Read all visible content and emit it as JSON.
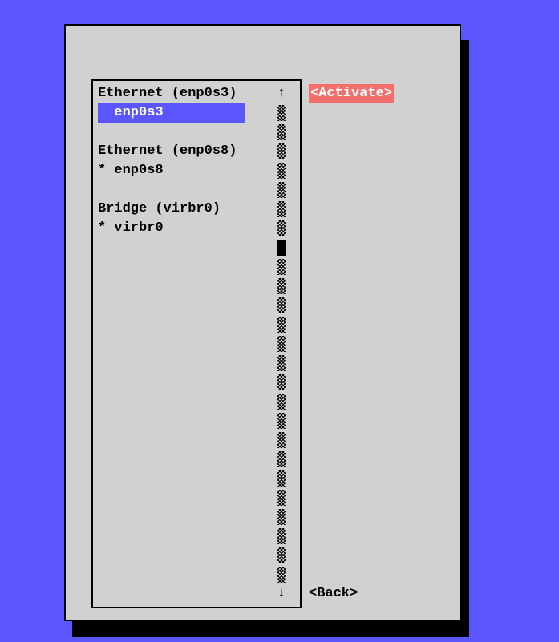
{
  "list": {
    "lines": [
      {
        "text": "Ethernet (enp0s3)",
        "selected": false,
        "prefix": ""
      },
      {
        "text": "enp0s3",
        "selected": true,
        "prefix": "  "
      },
      {
        "text": "",
        "selected": false,
        "prefix": ""
      },
      {
        "text": "Ethernet (enp0s8)",
        "selected": false,
        "prefix": ""
      },
      {
        "text": "* enp0s8",
        "selected": false,
        "prefix": ""
      },
      {
        "text": "",
        "selected": false,
        "prefix": ""
      },
      {
        "text": "Bridge (virbr0)",
        "selected": false,
        "prefix": ""
      },
      {
        "text": "* virbr0",
        "selected": false,
        "prefix": ""
      }
    ]
  },
  "scroll": {
    "up_arrow": "↑",
    "down_arrow": "↓",
    "cells": 25,
    "thumb_index": 7
  },
  "buttons": {
    "activate": "<Activate>",
    "back": "<Back>"
  }
}
